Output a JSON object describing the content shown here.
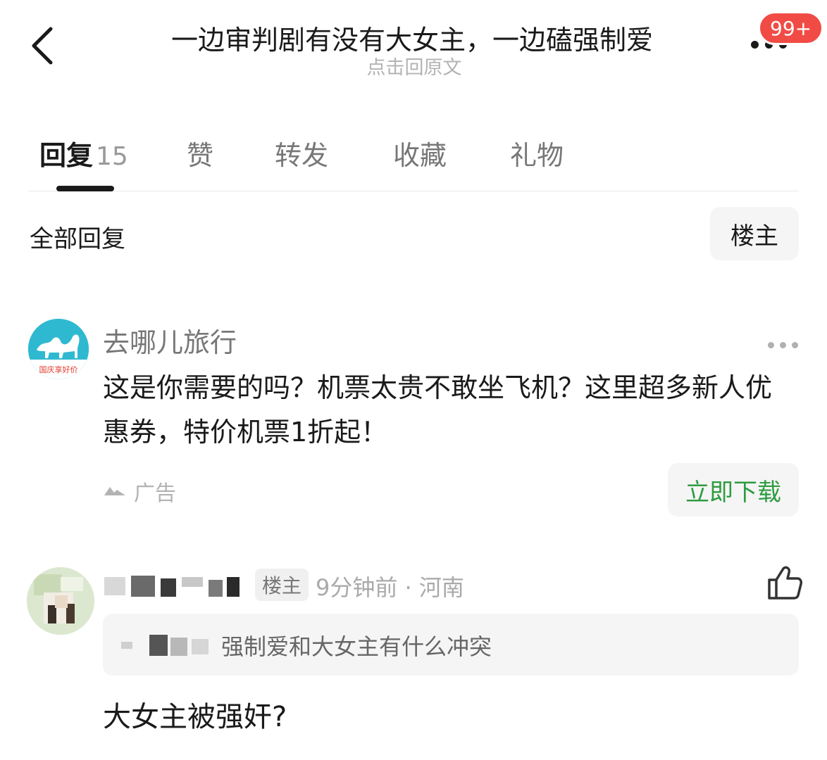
{
  "header": {
    "title": "一边审判剧有没有大女主，一边磕强制爱",
    "subtitle": "点击回原文",
    "badge": "99+",
    "back_icon": "chevron-left-icon",
    "more_icon": "more-horizontal-icon"
  },
  "tabs": [
    {
      "label": "回复",
      "count": "15"
    },
    {
      "label": "赞"
    },
    {
      "label": "转发"
    },
    {
      "label": "收藏"
    },
    {
      "label": "礼物"
    }
  ],
  "filter": {
    "all_replies": "全部回复",
    "op_only": "楼主"
  },
  "ad": {
    "name": "去哪儿旅行",
    "text": "这是你需要的吗？机票太贵不敢坐飞机？这里超多新人优惠券，特价机票1折起！",
    "label": "广告",
    "cta": "立即下载",
    "avatar_text": "国庆享好价"
  },
  "comment": {
    "op_tag": "楼主",
    "meta": "9分钟前 · 河南",
    "quote": "强制爱和大女主有什么冲突",
    "text": "大女主被强奸?",
    "like_icon": "thumbs-up-icon"
  },
  "colors": {
    "badge": "#f04c45",
    "cta": "#2e9c41",
    "ad_avatar": "#2fb9d0"
  }
}
